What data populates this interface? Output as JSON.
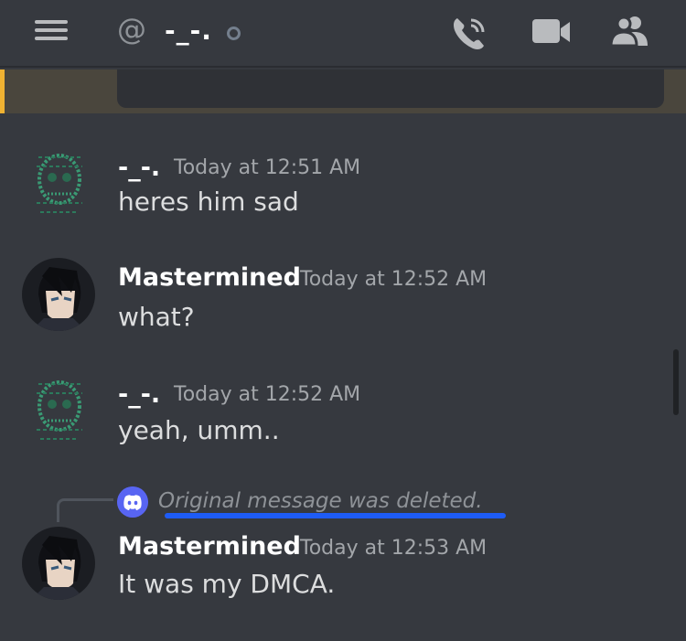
{
  "header": {
    "at_symbol": "@",
    "channel_name": "-_-.",
    "icons": [
      "menu-icon",
      "phone-call-icon",
      "video-call-icon",
      "members-icon"
    ]
  },
  "messages": [
    {
      "author": "-_-.",
      "timestamp": "Today at 12:51 AM",
      "text": "heres him sad"
    },
    {
      "author": "Mastermined",
      "timestamp": "Today at 12:52 AM",
      "text": "what?"
    },
    {
      "author": "-_-.",
      "timestamp": "Today at 12:52 AM",
      "text": "yeah, umm.."
    },
    {
      "reply_to": "Original message was deleted.",
      "author": "Mastermined",
      "timestamp": "Today at 12:53 AM",
      "text": "It was my DMCA."
    }
  ],
  "colors": {
    "background": "#36393f",
    "blurple": "#5865f2",
    "highlight_underline": "#1e5cf6",
    "embed_accent": "#f0b232"
  }
}
